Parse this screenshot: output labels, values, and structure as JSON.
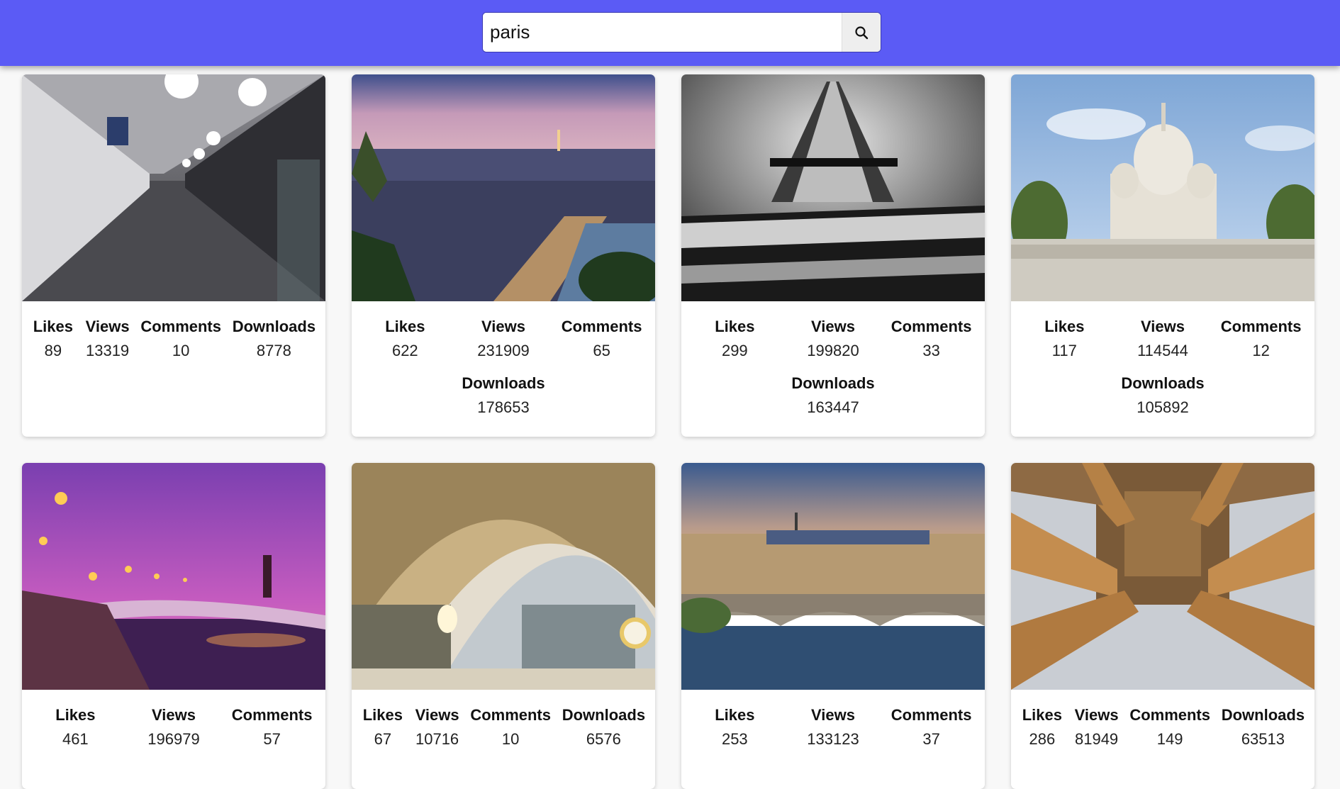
{
  "search": {
    "value": "paris"
  },
  "labels": {
    "likes": "Likes",
    "views": "Views",
    "comments": "Comments",
    "downloads": "Downloads"
  },
  "cards": [
    {
      "subject": "metro station Cité",
      "likes": "89",
      "views": "13319",
      "comments": "10",
      "downloads": "8778"
    },
    {
      "subject": "city skyline with gargoyle at dusk",
      "likes": "622",
      "views": "231909",
      "comments": "65",
      "downloads": "178653"
    },
    {
      "subject": "eiffel tower black and white",
      "likes": "299",
      "views": "199820",
      "comments": "33",
      "downloads": "163447"
    },
    {
      "subject": "sacré-cœur basilica",
      "likes": "117",
      "views": "114544",
      "comments": "12",
      "downloads": "105892"
    },
    {
      "subject": "pont alexandre III at sunset",
      "likes": "461",
      "views": "196979",
      "comments": "57"
    },
    {
      "subject": "musée d'orsay interior",
      "likes": "67",
      "views": "10716",
      "comments": "10",
      "downloads": "6576"
    },
    {
      "subject": "musée d'orsay from the seine",
      "likes": "253",
      "views": "133123",
      "comments": "37"
    },
    {
      "subject": "panthéon columns from below",
      "likes": "286",
      "views": "81949",
      "comments": "149",
      "downloads": "63513"
    }
  ]
}
